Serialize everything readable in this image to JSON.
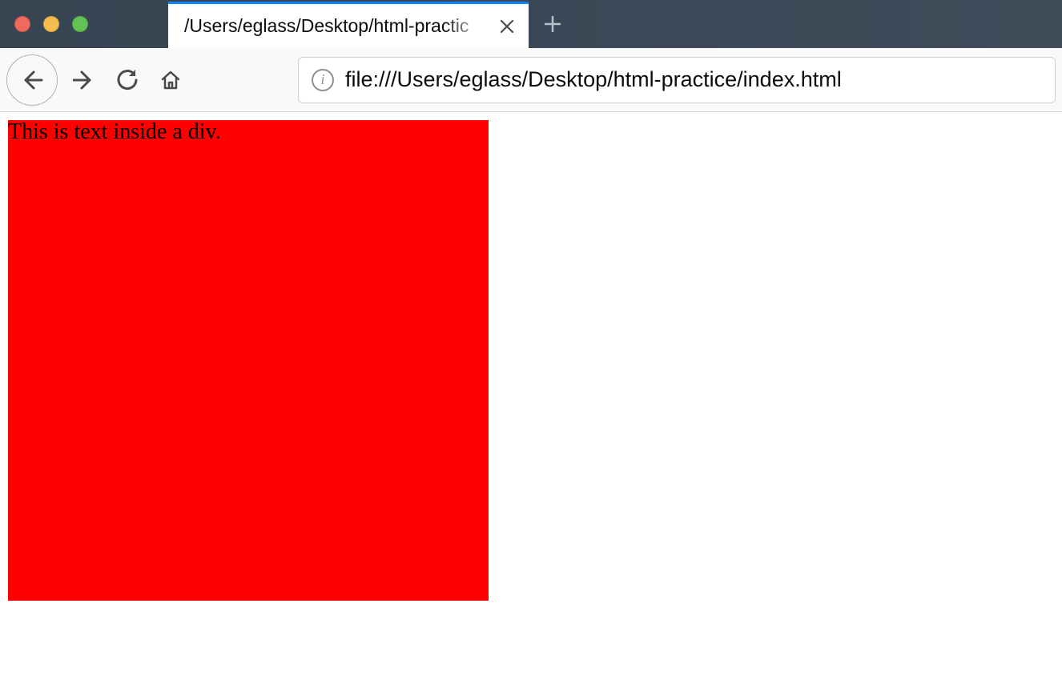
{
  "window": {
    "tab_title": "/Users/eglass/Desktop/html-practic"
  },
  "toolbar": {
    "url": "file:///Users/eglass/Desktop/html-practice/index.html",
    "info_glyph": "i"
  },
  "page": {
    "div_text": "This is text inside a div."
  }
}
